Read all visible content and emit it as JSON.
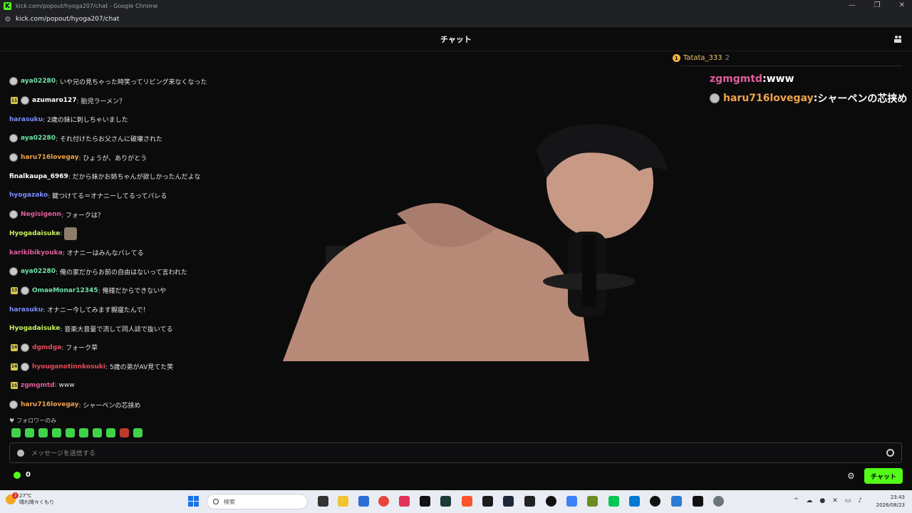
{
  "window": {
    "title": "kick.com/popout/hyoga207/chat - Google Chrome",
    "url": "kick.com/popout/hyoga207/chat",
    "logo_letter": "K",
    "controls": [
      "—",
      "❐",
      "✕"
    ]
  },
  "chat_header": {
    "title": "チャット"
  },
  "pinned_gifter": {
    "name": "Tatata_333",
    "count": "2",
    "crown": "1"
  },
  "overlay": [
    {
      "user": "zgmgmtd",
      "sep": " : ",
      "text": "www",
      "color": "#e15f9b",
      "avatar": false
    },
    {
      "user": "haru716lovegay",
      "sep": " : ",
      "text": "シャーペンの芯挟め",
      "color": "#f0a24b",
      "avatar": true
    }
  ],
  "messages": [
    {
      "user": "aya02280",
      "text": ": いや兄の見ちゃった時笑ってリビング来なくなった",
      "color": "#6fe3a6",
      "avatar": true,
      "badge": ""
    },
    {
      "user": "azumaro127",
      "text": ": 胎児ラーメン？",
      "color": "#ffffff",
      "avatar": true,
      "badge": "11"
    },
    {
      "user": "harasuku",
      "text": ": 2歳の妹に刺しちゃいました",
      "color": "#7b8cff",
      "avatar": false,
      "badge": ""
    },
    {
      "user": "aya02280",
      "text": ": それ付けたらお父さんに破壊された",
      "color": "#6fe3a6",
      "avatar": true,
      "badge": ""
    },
    {
      "user": "haru716lovegay",
      "text": ": ひょうが、ありがとう",
      "color": "#f0a24b",
      "avatar": true,
      "badge": ""
    },
    {
      "user": "finalkaupa_6969",
      "text": ": だから妹かお姉ちゃんが欲しかったんだよな",
      "color": "#ffffff",
      "avatar": false,
      "badge": ""
    },
    {
      "user": "hyogazako",
      "text": ": 鍵つけてる＝オナニーしてるってバレる",
      "color": "#7b8cff",
      "avatar": false,
      "badge": ""
    },
    {
      "user": "Negisigenn",
      "text": ": フォークは？",
      "color": "#e15f9b",
      "avatar": true,
      "badge": ""
    },
    {
      "user": "Hyogadaisuke",
      "text": ":",
      "color": "#c6f25a",
      "avatar": false,
      "badge": "",
      "emote": true
    },
    {
      "user": "karikibikyouka",
      "text": ": オナニーはみんなバレてる",
      "color": "#e15f9b",
      "avatar": false,
      "badge": ""
    },
    {
      "user": "aya02280",
      "text": ": 俺の家だからお前の自由はないって言われた",
      "color": "#6fe3a6",
      "avatar": true,
      "badge": ""
    },
    {
      "user": "OmaeMonar12345",
      "text": ": 俺様だからできないや",
      "color": "#6fe3a6",
      "avatar": true,
      "badge": "13"
    },
    {
      "user": "harasuku",
      "text": ": オナニー今してみます親寝たんで！",
      "color": "#7b8cff",
      "avatar": false,
      "badge": ""
    },
    {
      "user": "Hyogadaisuke",
      "text": ": 音楽大音量で流して同人誌で抜いてる",
      "color": "#c6f25a",
      "avatar": false,
      "badge": ""
    },
    {
      "user": "dgmdga",
      "text": ": フォーク草",
      "color": "#e74c5a",
      "avatar": true,
      "badge": "14"
    },
    {
      "user": "hyouganotinnkosuki",
      "text": ": 5歳の弟がAV見てた笑",
      "color": "#e74c5a",
      "avatar": true,
      "badge": "14"
    },
    {
      "user": "zgmgmtd",
      "text": ": www",
      "color": "#e15f9b",
      "avatar": false,
      "badge": "15"
    },
    {
      "user": "haru716lovegay",
      "text": ": シャーペンの芯挟め",
      "color": "#f0a24b",
      "avatar": true,
      "badge": ""
    }
  ],
  "followers_only": "フォロワーのみ",
  "input": {
    "placeholder": "メッセージを送信する"
  },
  "points": {
    "value": "0"
  },
  "chat_button": "チャット",
  "taskbar": {
    "weather_temp": "27°C",
    "weather_text": "晴れ時々くもり",
    "weather_badge": "2",
    "search_placeholder": "検索",
    "time": "23:43",
    "date": "2026/08/23"
  },
  "colors": {
    "accent": "#53fc18"
  }
}
